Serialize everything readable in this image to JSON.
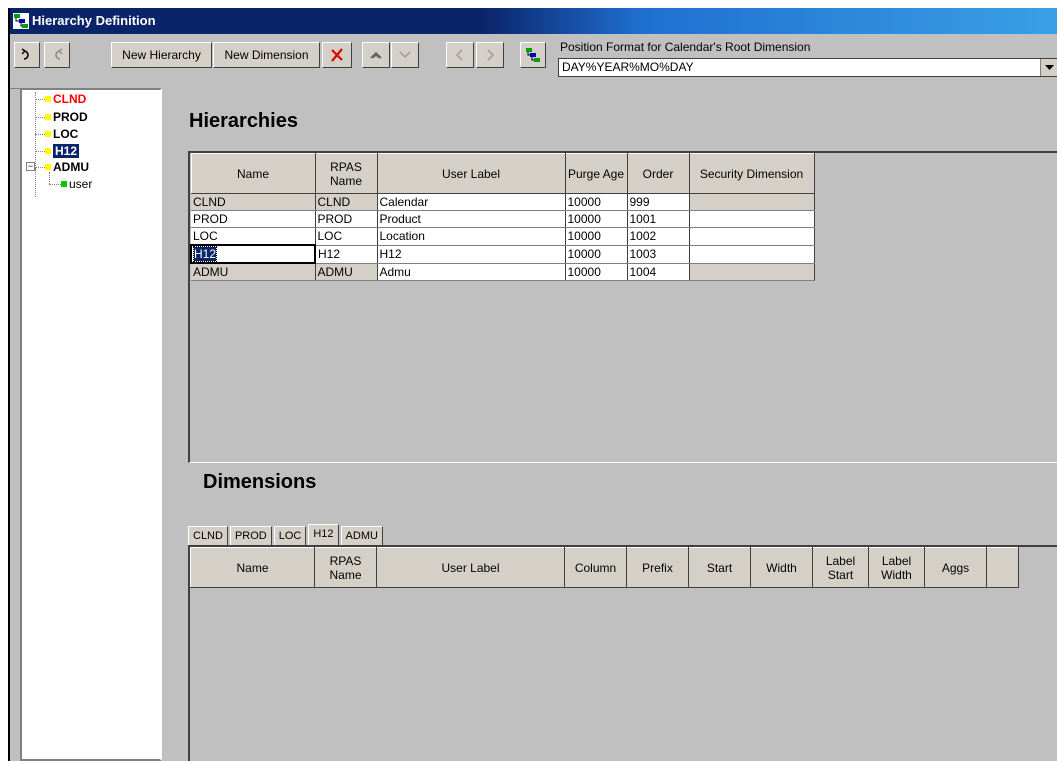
{
  "window": {
    "title": "Hierarchy Definition",
    "icon": "hierarchy-icon"
  },
  "toolbar": {
    "undo_icon": "undo-icon",
    "redo_icon": "redo-icon",
    "new_hierarchy_label": "New Hierarchy",
    "new_dimension_label": "New Dimension",
    "delete_icon": "delete-x-icon",
    "move_up_icon": "chevron-up-icon",
    "move_down_icon": "chevron-down-icon",
    "move_left_icon": "chevron-left-icon",
    "move_right_icon": "chevron-right-icon",
    "tree_icon": "hierarchy-tree-icon",
    "position_format_label": "Position Format for Calendar's Root Dimension",
    "position_format_value": "DAY%YEAR%MO%DAY"
  },
  "tree": {
    "nodes": [
      {
        "label": "CLND",
        "color": "#ff0000",
        "selected": false
      },
      {
        "label": "PROD",
        "color": "#000000",
        "selected": false
      },
      {
        "label": "LOC",
        "color": "#000000",
        "selected": false
      },
      {
        "label": "H12",
        "color": "#ffffff",
        "selected": true
      },
      {
        "label": "ADMU",
        "color": "#000000",
        "selected": false,
        "expanded": true
      }
    ],
    "child": {
      "label": "user"
    }
  },
  "hierarchies": {
    "title": "Hierarchies",
    "columns": [
      "Name",
      "RPAS Name",
      "User Label",
      "Purge Age",
      "Order",
      "Security Dimension"
    ],
    "rows": [
      [
        "CLND",
        "CLND",
        "Calendar",
        "10000",
        "999",
        ""
      ],
      [
        "PROD",
        "PROD",
        "Product",
        "10000",
        "1001",
        ""
      ],
      [
        "LOC",
        "LOC",
        "Location",
        "10000",
        "1002",
        ""
      ],
      [
        "H12",
        "H12",
        "H12",
        "10000",
        "1003",
        ""
      ],
      [
        "ADMU",
        "ADMU",
        "Admu",
        "10000",
        "1004",
        ""
      ]
    ]
  },
  "dimensions": {
    "title": "Dimensions",
    "tabs": [
      "CLND",
      "PROD",
      "LOC",
      "H12",
      "ADMU"
    ],
    "active_tab": "H12",
    "columns": [
      "Name",
      "RPAS Name",
      "User Label",
      "Column",
      "Prefix",
      "Start",
      "Width",
      "Label Start",
      "Label Width",
      "Aggs",
      ""
    ]
  },
  "colors": {
    "accent": "#0a246a",
    "selection": "#0a246a",
    "clnd_node": "#ff0000",
    "node_square": "#ffff00",
    "child_square": "#00cc00"
  }
}
